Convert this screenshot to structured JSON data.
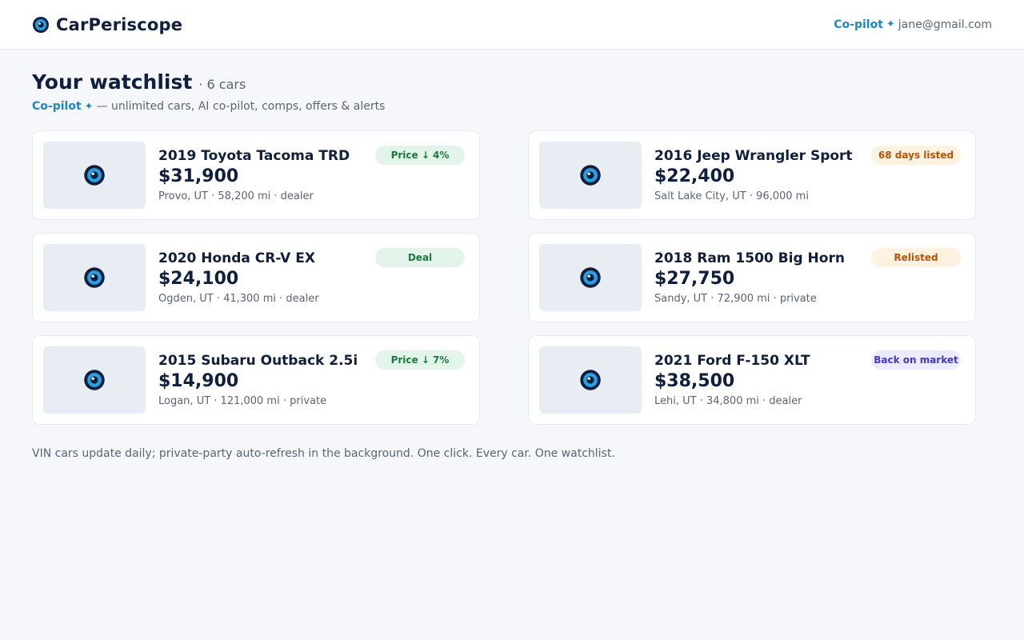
{
  "brand": {
    "name": "CarPeriscope",
    "logo_icon": "periscope-eye-icon"
  },
  "header": {
    "copilot_label": "Co-pilot",
    "copilot_icon": "✦",
    "user_email": "jane@gmail.com"
  },
  "page": {
    "title": "Your watchlist",
    "count": "· 6 cars",
    "subtitle_copilot": "Co-pilot",
    "subtitle_icon": "✦",
    "subtitle_text": "— unlimited cars, AI co-pilot, comps, offers & alerts"
  },
  "cars": [
    {
      "title": "2019 Toyota Tacoma TRD",
      "price": "$31,900",
      "meta": "Provo, UT · 58,200 mi · dealer",
      "badge": "Price ↓ 4%",
      "badge_style": "green"
    },
    {
      "title": "2016 Jeep Wrangler Sport",
      "price": "$22,400",
      "meta": "Salt Lake City, UT · 96,000 mi",
      "badge": "68 days listed",
      "badge_style": "orange"
    },
    {
      "title": "2020 Honda CR-V EX",
      "price": "$24,100",
      "meta": "Ogden, UT · 41,300 mi · dealer",
      "badge": "Deal",
      "badge_style": "green"
    },
    {
      "title": "2018 Ram 1500 Big Horn",
      "price": "$27,750",
      "meta": "Sandy, UT · 72,900 mi · private",
      "badge": "Relisted",
      "badge_style": "orange"
    },
    {
      "title": "2015 Subaru Outback 2.5i",
      "price": "$14,900",
      "meta": "Logan, UT · 121,000 mi · private",
      "badge": "Price ↓ 7%",
      "badge_style": "green"
    },
    {
      "title": "2021 Ford F-150 XLT",
      "price": "$38,500",
      "meta": "Lehi, UT · 34,800 mi · dealer",
      "badge": "Back on market",
      "badge_style": "purple"
    }
  ],
  "colors": {
    "brand_navy": "#0f1f3d",
    "accent_blue": "#1f86c8",
    "eye_blue": "#2b9fe0",
    "badge_green": "#1b7a3e",
    "badge_orange": "#b45309",
    "badge_purple": "#4338ca"
  },
  "footer": {
    "note": "VIN cars update daily; private-party auto-refresh in the background. One click. Every car. One watchlist."
  }
}
